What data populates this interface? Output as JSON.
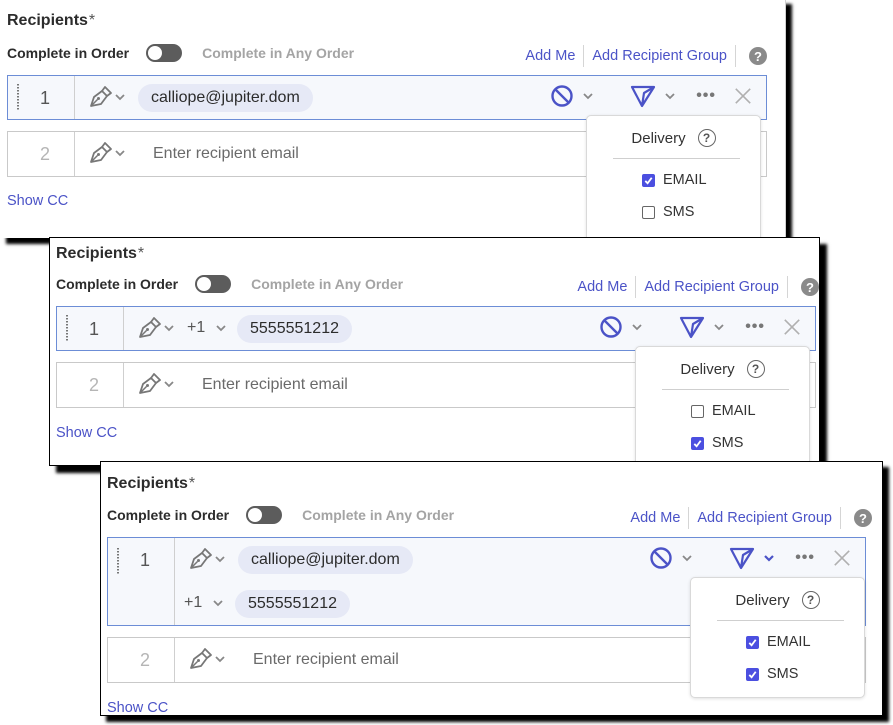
{
  "colors": {
    "accent": "#4b53c7",
    "checkbox": "#4b4fe0",
    "chip": "#e6e9f6",
    "active_border": "#6c8dd6"
  },
  "panels": [
    {
      "title": "Recipients",
      "required": "*",
      "order_label": "Complete in Order",
      "any_order_label": "Complete in Any Order",
      "add_me": "Add Me",
      "add_group": "Add Recipient Group",
      "help": "?",
      "rows": [
        {
          "number": "1",
          "email": "calliope@jupiter.dom",
          "role_icon": "pen-icon"
        },
        {
          "number": "2",
          "placeholder": "Enter recipient email",
          "role_icon": "pen-icon"
        }
      ],
      "show_cc": "Show CC",
      "delivery": {
        "title": "Delivery",
        "help": "?",
        "options": [
          {
            "label": "EMAIL",
            "checked": true
          },
          {
            "label": "SMS",
            "checked": false
          }
        ]
      }
    },
    {
      "title": "Recipients",
      "required": "*",
      "order_label": "Complete in Order",
      "any_order_label": "Complete in Any Order",
      "add_me": "Add Me",
      "add_group": "Add Recipient Group",
      "help": "?",
      "rows": [
        {
          "number": "1",
          "country_code": "+1",
          "phone": "5555551212",
          "role_icon": "pen-icon"
        },
        {
          "number": "2",
          "placeholder": "Enter recipient email",
          "role_icon": "pen-icon"
        }
      ],
      "show_cc": "Show CC",
      "delivery": {
        "title": "Delivery",
        "help": "?",
        "options": [
          {
            "label": "EMAIL",
            "checked": false
          },
          {
            "label": "SMS",
            "checked": true
          }
        ]
      }
    },
    {
      "title": "Recipients",
      "required": "*",
      "order_label": "Complete in Order",
      "any_order_label": "Complete in Any Order",
      "add_me": "Add Me",
      "add_group": "Add Recipient Group",
      "help": "?",
      "rows": [
        {
          "number": "1",
          "email": "calliope@jupiter.dom",
          "country_code": "+1",
          "phone": "5555551212",
          "role_icon": "pen-icon"
        },
        {
          "number": "2",
          "placeholder": "Enter recipient email",
          "role_icon": "pen-icon"
        }
      ],
      "show_cc": "Show CC",
      "delivery": {
        "title": "Delivery",
        "help": "?",
        "options": [
          {
            "label": "EMAIL",
            "checked": true
          },
          {
            "label": "SMS",
            "checked": true
          }
        ]
      }
    }
  ]
}
